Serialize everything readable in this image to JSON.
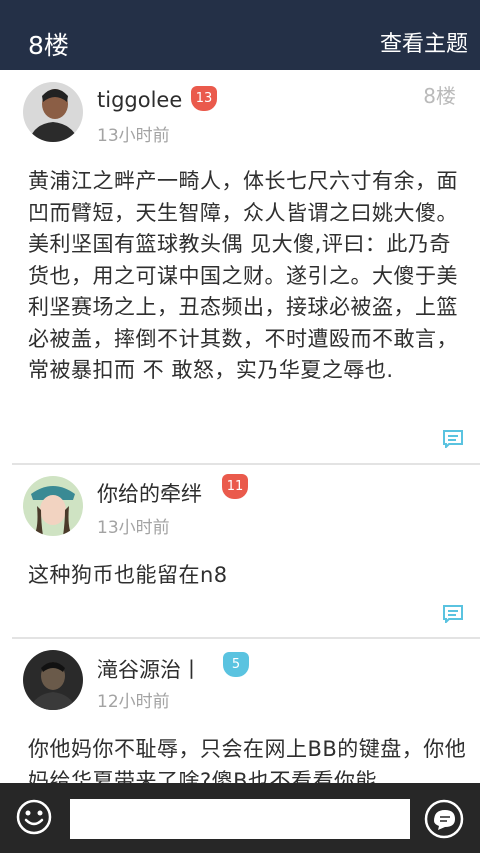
{
  "header": {
    "title": "8楼",
    "view_topic": "查看主题"
  },
  "posts": [
    {
      "username": "tiggolee",
      "badge": "13",
      "time": "13小时前",
      "floor": "8楼",
      "text": "黄浦江之畔产一畸人，体长七尺六寸有余，面凹而臂短，天生智障，众人皆谓之曰姚大傻。美利坚国有篮球教头偶 见大傻,评曰：此乃奇货也，用之可谋中国之财。遂引之。大傻于美利坚赛场之上，丑态频出，接球必被盗，上篮必被盖，摔倒不计其数，不时遭殴而不敢言，常被暴扣而 不 敢怒，实乃华夏之辱也."
    },
    {
      "username": "你给的牵绊",
      "badge": "11",
      "time": "13小时前",
      "text": "这种狗币也能留在n8"
    },
    {
      "username": "滝谷源治丨",
      "badge": "5",
      "time": "12小时前",
      "text": "你他妈你不耻辱，只会在网上BB的键盘，你他妈给华夏带来了啥?傻B也不看看你能"
    }
  ],
  "footer": {
    "input_placeholder": ""
  },
  "colors": {
    "header_bg": "#243047",
    "accent": "#5ac3e0",
    "badge_red": "#ea5a4c",
    "footer_bg": "#272727"
  }
}
